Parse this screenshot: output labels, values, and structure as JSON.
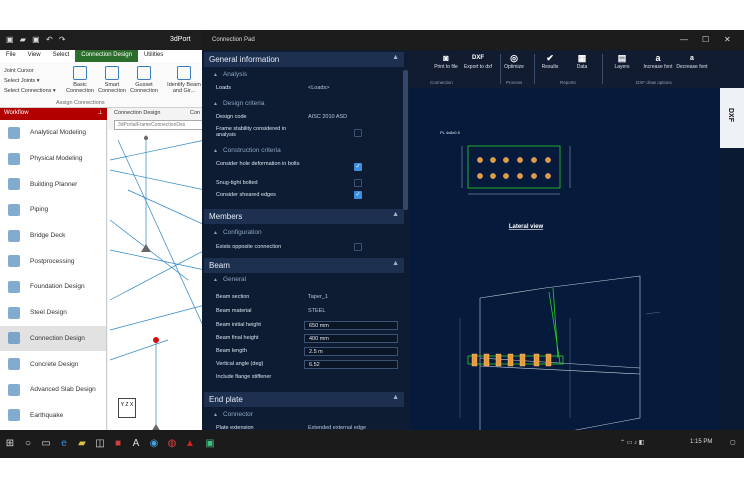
{
  "host_app": {
    "title": "3dPort",
    "menu": [
      "File",
      "View",
      "Select",
      "Connection Design",
      "Utilities"
    ],
    "ribbon": {
      "left_items": [
        "Joint Cursor",
        "Select Joints ▾",
        "Select Connections ▾"
      ],
      "buttons": [
        {
          "label": "Basic Connection"
        },
        {
          "label": "Smart Connection"
        },
        {
          "label": "Gusset Connection"
        },
        {
          "label": "Identify Beam and Gir..."
        }
      ],
      "group_label": "Assign Connections"
    },
    "workflow": {
      "title": "Workflow",
      "items": [
        {
          "label": "Analytical Modeling"
        },
        {
          "label": "Physical Modeling"
        },
        {
          "label": "Building Planner"
        },
        {
          "label": "Piping"
        },
        {
          "label": "Bridge Deck"
        },
        {
          "label": "Postprocessing"
        },
        {
          "label": "Foundation Design"
        },
        {
          "label": "Steel Design"
        },
        {
          "label": "Connection Design",
          "active": true
        },
        {
          "label": "Concrete Design"
        },
        {
          "label": "Advanced Slab Design"
        },
        {
          "label": "Earthquake"
        }
      ]
    },
    "view_tabs": [
      "Connection Design",
      "Con"
    ],
    "document_tab": "3dPortalFrameConnectionDes",
    "axis_label": "Y Z X"
  },
  "pad": {
    "title": "Connection Pad",
    "general_info": {
      "title": "General information",
      "analysis": {
        "title": "Analysis",
        "loads_label": "Loads",
        "loads_value": "<Loads>"
      },
      "design_criteria": {
        "title": "Design criteria",
        "design_code_label": "Design code",
        "design_code_value": "AISC 2010 ASD",
        "frame_stability_label": "Frame stability considered in analysis"
      },
      "construction_criteria": {
        "title": "Construction criteria",
        "hole_deformation_label": "Consider hole deformation in bolts",
        "snug_tight_label": "Snug-tight bolted",
        "sheared_edges_label": "Consider sheared edges"
      }
    },
    "members": {
      "title": "Members",
      "configuration_title": "Configuration",
      "exists_opposite_label": "Exists opposite connection"
    },
    "beam": {
      "title": "Beam",
      "general_title": "General",
      "rows": [
        {
          "label": "Beam section",
          "value": "Taper_1"
        },
        {
          "label": "Beam material",
          "value": "STEEL"
        },
        {
          "label": "Beam initial height",
          "value": "650 mm"
        },
        {
          "label": "Beam final height",
          "value": "400 mm"
        },
        {
          "label": "Beam length",
          "value": "2.5 m"
        },
        {
          "label": "Vertical angle (deg)",
          "value": "6.52"
        },
        {
          "label": "Include flange stiffener",
          "value": ""
        }
      ]
    },
    "end_plate": {
      "title": "End plate",
      "connector_title": "Connector",
      "plate_extension_label": "Plate extension",
      "plate_extension_value": "Extended external edge"
    }
  },
  "dxf_toolbar": {
    "buttons": [
      {
        "icon": "camera-icon",
        "label": "Print to file"
      },
      {
        "icon": "dxf-export-icon",
        "label": "Export to dxf"
      },
      {
        "icon": "optimize-icon",
        "label": "Optimize"
      },
      {
        "icon": "results-icon",
        "label": "Results"
      },
      {
        "icon": "data-icon",
        "label": "Data"
      },
      {
        "icon": "layers-icon",
        "label": "Layers"
      },
      {
        "icon": "increase-font-icon",
        "label": "Increase font"
      },
      {
        "icon": "decrease-font-icon",
        "label": "Decrease font"
      }
    ],
    "groups": [
      "Connection",
      "Process",
      "Reports",
      "DXF draw options"
    ],
    "side_tab": "DXF",
    "export_text": "DXF",
    "increase_glyph": "a",
    "decrease_glyph": "a"
  },
  "drawing": {
    "plate_label": "PL 4x8x0.5",
    "lateral_view": "Lateral view"
  },
  "taskbar": {
    "time": "1:15 PM"
  },
  "colors": {
    "pad_bg": "#0d1c33",
    "dxf_bg": "#061a3c",
    "accent_red": "#b20000",
    "checkbox": "#3b8ee0"
  }
}
